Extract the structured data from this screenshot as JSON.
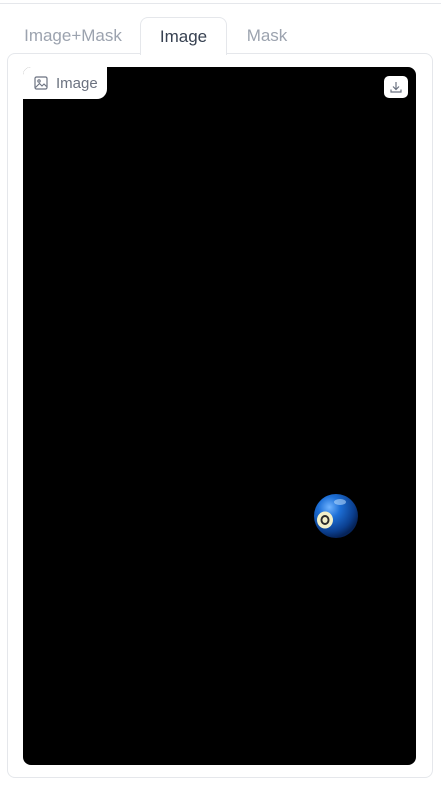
{
  "tabs": [
    {
      "label": "Image+Mask",
      "active": false
    },
    {
      "label": "Image",
      "active": true
    },
    {
      "label": "Mask",
      "active": false
    }
  ],
  "image_panel": {
    "label": "Image",
    "label_icon": "image-icon",
    "download_icon": "download-icon"
  },
  "colors": {
    "canvas_bg": "#000000",
    "active_tab_text": "#374151",
    "inactive_tab_text": "#9ca3af",
    "border": "#e5e7eb",
    "ball_blue": "#1d6fd6"
  }
}
